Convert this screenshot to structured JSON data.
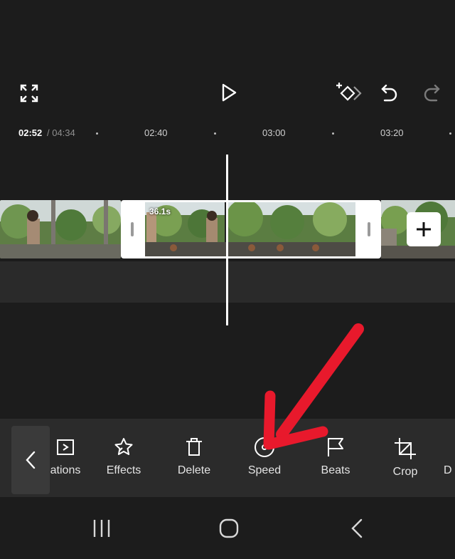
{
  "player": {
    "fullscreen_icon": "fullscreen-icon",
    "play_icon": "play-icon",
    "keyframe_icon": "add-keyframe-icon",
    "undo_icon": "undo-icon",
    "redo_icon": "redo-icon"
  },
  "ruler": {
    "current_time": "02:52",
    "total_time": "/ 04:34",
    "marks": [
      "02:40",
      "03:00",
      "03:20"
    ]
  },
  "timeline": {
    "selected_clip_duration": "36.1s",
    "add_clip_icon": "plus-icon"
  },
  "toolbar": {
    "back_icon": "chevron-left-icon",
    "tools": [
      {
        "label": "ations",
        "icon": "animations-icon"
      },
      {
        "label": "Effects",
        "icon": "effects-icon"
      },
      {
        "label": "Delete",
        "icon": "trash-icon"
      },
      {
        "label": "Speed",
        "icon": "speed-icon"
      },
      {
        "label": "Beats",
        "icon": "flag-icon"
      },
      {
        "label": "Crop",
        "icon": "crop-icon"
      },
      {
        "label": "D",
        "icon": ""
      }
    ]
  },
  "navigation": {
    "recents_icon": "recents-icon",
    "home_icon": "home-icon",
    "back_icon": "back-icon"
  },
  "colors": {
    "background": "#1c1c1c",
    "toolbar": "#2b2b2b",
    "annotation_arrow": "#e8192c"
  }
}
